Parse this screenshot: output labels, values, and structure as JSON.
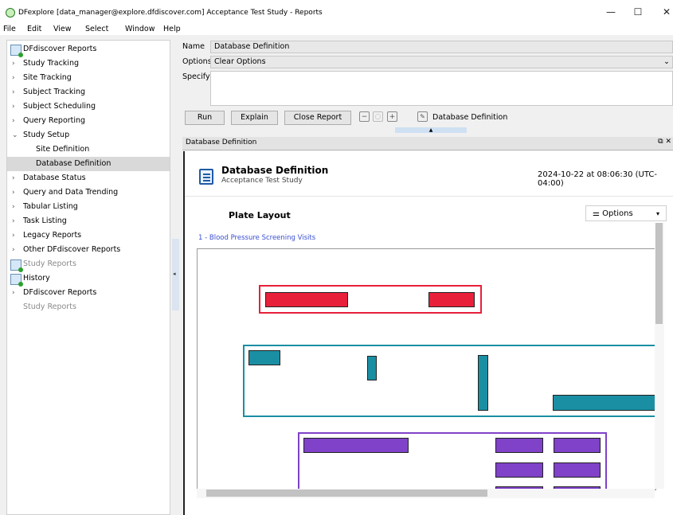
{
  "window": {
    "title": "DFexplore [data_manager@explore.dfdiscover.com] Acceptance Test Study - Reports",
    "minimize": "—",
    "maximize": "☐",
    "close": "✕"
  },
  "menu": [
    "File",
    "Edit",
    "View",
    "Select",
    "Window",
    "Help"
  ],
  "sidebar": {
    "root": "DFdiscover Reports",
    "items": [
      {
        "label": "Study Tracking",
        "chev": "›"
      },
      {
        "label": "Site Tracking",
        "chev": "›"
      },
      {
        "label": "Subject Tracking",
        "chev": "›"
      },
      {
        "label": "Subject Scheduling",
        "chev": "›"
      },
      {
        "label": "Query Reporting",
        "chev": "›"
      },
      {
        "label": "Study Setup",
        "chev": "⌄"
      },
      {
        "label": "Site Definition",
        "chev": ""
      },
      {
        "label": "Database Definition",
        "chev": ""
      },
      {
        "label": "Database Status",
        "chev": "›"
      },
      {
        "label": "Query and Data Trending",
        "chev": "›"
      },
      {
        "label": "Tabular Listing",
        "chev": "›"
      },
      {
        "label": "Task Listing",
        "chev": "›"
      },
      {
        "label": "Legacy Reports",
        "chev": "›"
      },
      {
        "label": "Other DFdiscover Reports",
        "chev": "›"
      }
    ],
    "study_reports": "Study Reports",
    "history": "History",
    "history_items": [
      {
        "label": "DFdiscover Reports",
        "chev": "›"
      },
      {
        "label": "Study Reports",
        "chev": ""
      }
    ],
    "splitter_arrow": "◂"
  },
  "form": {
    "name_label": "Name",
    "name_value": "Database Definition",
    "options_label": "Options",
    "options_value": "Clear Options",
    "options_arrow": "⌄",
    "specify_label": "Specify",
    "specify_value": ""
  },
  "toolbar": {
    "run": "Run",
    "explain": "Explain",
    "close_report": "Close Report",
    "zoom_out": "−",
    "zoom_reset": "○",
    "zoom_in": "+",
    "current_report": "Database Definition",
    "collapse_arrow": "▲"
  },
  "panel": {
    "title": "Database Definition",
    "controls": "⧉ ✕"
  },
  "report": {
    "title": "Database Definition",
    "subtitle": "Acceptance Test Study",
    "timestamp": "2024-10-22 at 08:06:30 (UTC-04:00)",
    "section": "Plate Layout",
    "options_label": "⚌ Options",
    "options_arrow": "▾",
    "plate_link": "1 - Blood Pressure Screening Visits"
  },
  "colors": {
    "red": "#e8203a",
    "teal": "#1a8fa3",
    "purple": "#7f42c8",
    "link": "#3a4fd0"
  }
}
